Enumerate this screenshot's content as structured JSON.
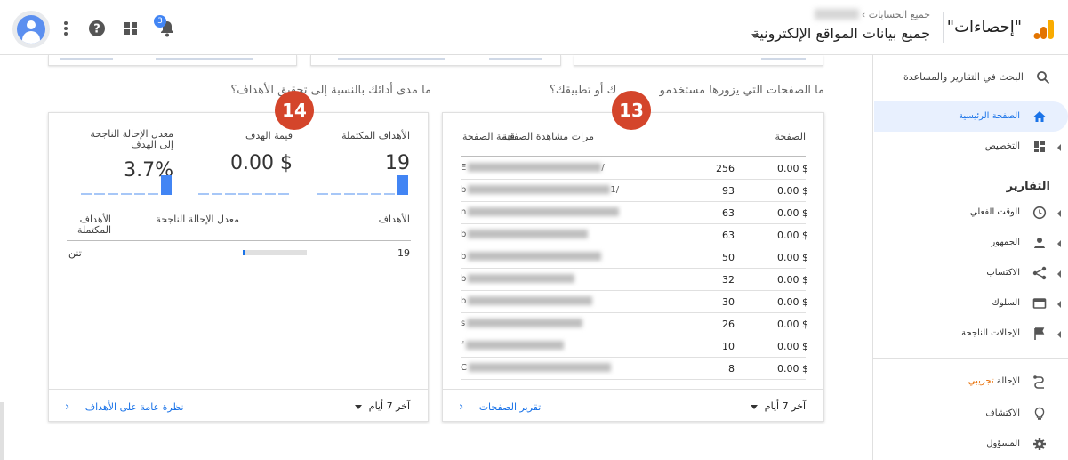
{
  "header": {
    "app_name": "\"إحصاءات\"",
    "breadcrumb": "جميع الحسابات ›",
    "property": "جميع بيانات المواقع الإلكترونية",
    "notification_count": "3"
  },
  "sidebar": {
    "search_label": "البحث في التقارير والمساعدة",
    "items": [
      {
        "label": "الصفحة الرئيسية",
        "icon": "home-icon"
      },
      {
        "label": "التخصيص",
        "icon": "dashboard-icon"
      },
      {
        "label": "الوقت الفعلي",
        "icon": "clock-icon"
      },
      {
        "label": "الجمهور",
        "icon": "person-icon"
      },
      {
        "label": "الاكتساب",
        "icon": "acquisition-icon"
      },
      {
        "label": "السلوك",
        "icon": "behavior-icon"
      },
      {
        "label": "الإحالات الناجحة",
        "icon": "flag-icon"
      },
      {
        "label": "الإحالة",
        "beta": "تجريبي",
        "icon": "attribution-icon"
      },
      {
        "label": "الاكتشاف",
        "icon": "lightbulb-icon"
      },
      {
        "label": "المسؤول",
        "icon": "gear-icon"
      }
    ],
    "section_reports": "التقارير"
  },
  "pages_card": {
    "question_start": "ما الصفحات التي يزورها مستخدمو",
    "question_end": "ك أو تطبيقك؟",
    "col_page": "الصفحة",
    "col_views": "مرات مشاهدة الصفحة",
    "col_value": "قيمة الصفحة",
    "rows": [
      {
        "path_prefix": "E",
        "path_suffix": "/",
        "views": "256",
        "value": "0.00 $"
      },
      {
        "path_prefix": "b",
        "path_suffix": "1/",
        "views": "93",
        "value": "0.00 $"
      },
      {
        "path_prefix": "n",
        "path_suffix": "",
        "views": "63",
        "value": "0.00 $"
      },
      {
        "path_prefix": "b",
        "path_suffix": "",
        "views": "63",
        "value": "0.00 $"
      },
      {
        "path_prefix": "b",
        "path_suffix": "",
        "views": "50",
        "value": "0.00 $"
      },
      {
        "path_prefix": "b",
        "path_suffix": "",
        "views": "32",
        "value": "0.00 $"
      },
      {
        "path_prefix": "b",
        "path_suffix": "",
        "views": "30",
        "value": "0.00 $"
      },
      {
        "path_prefix": "s",
        "path_suffix": "",
        "views": "26",
        "value": "0.00 $"
      },
      {
        "path_prefix": "f",
        "path_suffix": "",
        "views": "10",
        "value": "0.00 $"
      },
      {
        "path_prefix": "C",
        "path_suffix": "",
        "views": "8",
        "value": "0.00 $"
      }
    ],
    "date_range": "آخر 7 أيام",
    "report_link": "تقرير الصفحات",
    "badge": "13"
  },
  "goals_card": {
    "question": "ما مدى أدائك بالنسبة إلى تحقيق الأهداف؟",
    "metric1_label": "الأهداف المكتملة",
    "metric1_value": "19",
    "metric2_label": "قيمة الهدف",
    "metric2_value": "0.00 $",
    "metric3_label": "معدل الإحالة الناجحة إلى الهدف",
    "metric3_value": "3.7%",
    "col_goals": "الأهداف",
    "col_conv_rate": "معدل الإحالة الناجحة",
    "col_completed": "الأهداف المكتملة",
    "row_goal": "19",
    "row_name": "تنن",
    "row_progress": 0.04,
    "date_range": "آخر 7 أيام",
    "report_link": "نظرة عامة على الأهداف",
    "badge": "14"
  },
  "colors": {
    "accent": "#1a73e8",
    "badge": "#d4452b",
    "spark": "#4285f4"
  }
}
